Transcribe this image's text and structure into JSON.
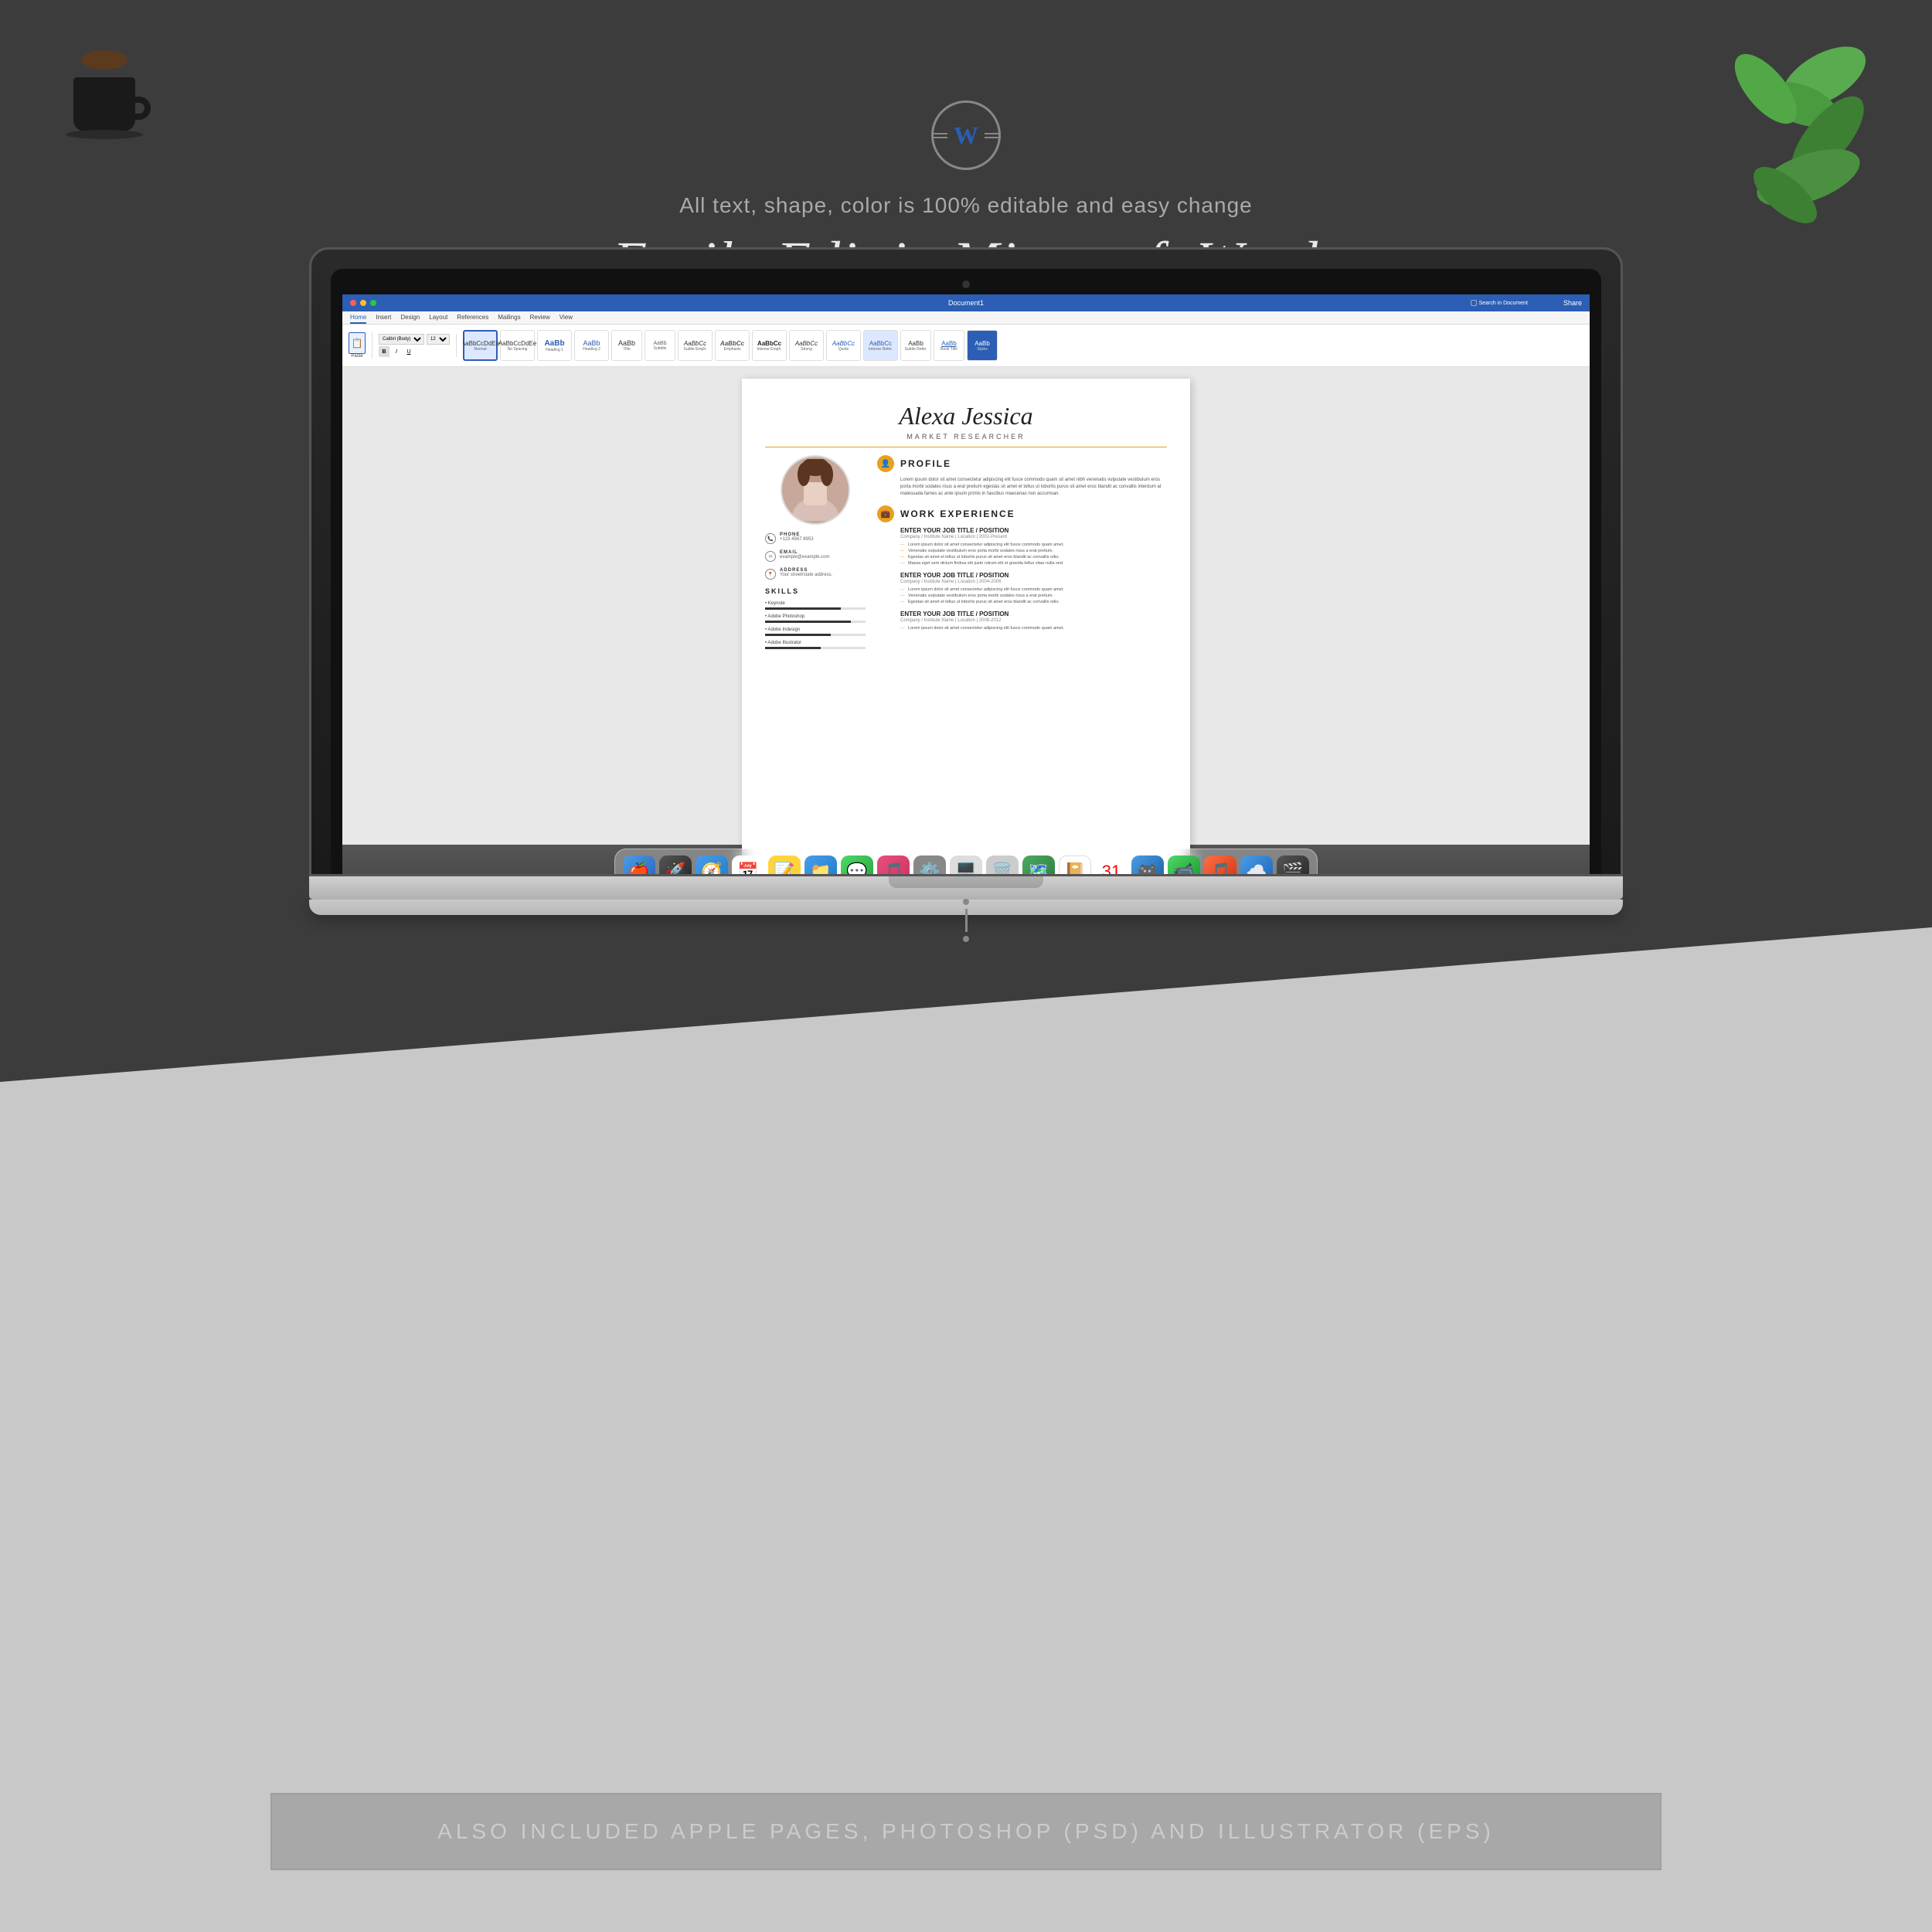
{
  "page": {
    "background_top": "#3c3c3c",
    "background_bottom": "#c8c8c8"
  },
  "header": {
    "icon_label": "W",
    "subtitle": "All text, shape, color is 100% editable and easy change",
    "main_title": "Easily Edit in Microsoft Word"
  },
  "laptop": {
    "title_bar": "Document1",
    "search_placeholder": "Search in Document",
    "share_label": "Share",
    "ribbon_tabs": [
      "Home",
      "Insert",
      "Design",
      "Layout",
      "References",
      "Mailings",
      "Review",
      "View"
    ],
    "active_tab": "Home"
  },
  "resume": {
    "name": "Alexa Jessica",
    "job_title": "MARKET RESEARCHER",
    "sections": {
      "profile": {
        "title": "PROFILE",
        "text": "Lorem ipsum dolor sit amet consectetur adipiscing elit fusce commodo quam sit amet nibh venenatis vulputate vestibulum eros porta morbi sodales risus a erat pretium egestas sit amet et tellus ut lobortis purus sit amet eros blandit ac convallis interdum at malesuada fames ac ante ipsum primis in faucibus maecenas non accumsan."
      },
      "work_experience": {
        "title": "WORK EXPERIENCE",
        "jobs": [
          {
            "title": "ENTER YOUR JOB TITLE / POSITION",
            "company": "Company / Institute Name  |  Location  |  2002-Present",
            "bullets": [
              "Lorem ipsum dolor sit amet consectetur adipiscing elit fusce commodo quam amet.",
              "Venenatis vulputate vestibulum eros porta morbi sodales risus a erat pretium.",
              "Egestas sit amet et tellus ut lobortis purus sit amet eros blandit ac convallis odio.",
              "Massa eget sem dictum finibus  elit justo rutrum elit et gravida tellus vitae nulla sed."
            ]
          },
          {
            "title": "ENTER YOUR JOB TITLE / POSITION",
            "company": "Company / Institute Name  |  Location  |  2004-2006",
            "bullets": [
              "Lorem ipsum dolor sit amet consectetur adipiscing elit fusce commodo quam amet.",
              "Venenatis vulputate vestibulum eros porta morbi sodales risus a erat pretium.",
              "Egestas sit amet et tellus ut lobortis purus sit amet eros blandit ac convallis odio."
            ]
          },
          {
            "title": "ENTER YOUR JOB TITLE / POSITION",
            "company": "Company / Institute Name  |  Location  |  2008-2012",
            "bullets": [
              "Lorem ipsum dolor sit amet consectetur adipiscing elit fusce commodo quam amet."
            ]
          }
        ]
      }
    },
    "contact": {
      "phone_label": "PHONE",
      "phone_value": "+123 4567 8953",
      "email_label": "EMAIL",
      "email_value": "example@example.com",
      "address_label": "ADDRESS",
      "address_value": "Your street/state address."
    },
    "skills": {
      "title": "SKILLS",
      "items": [
        {
          "name": "Keynote",
          "level": 75
        },
        {
          "name": "Adobe Photoshop",
          "level": 85
        },
        {
          "name": "Adobe Indesign",
          "level": 65
        },
        {
          "name": "Adobe Illustrator",
          "level": 55
        }
      ]
    }
  },
  "dock": {
    "icons": [
      "🍎",
      "🚀",
      "🧭",
      "📅",
      "📝",
      "📁",
      "💬",
      "🎵",
      "⚙️",
      "🖥️",
      "🗑️",
      "🗺️",
      "📔",
      "📅",
      "🎮",
      "💬",
      "🎵",
      "☁️",
      "🎬"
    ]
  },
  "footer": {
    "text": "ALSO INCLUDED APPLE PAGES, PHOTOSHOP (PSD) AND ILLUSTRATOR (EPS)"
  }
}
